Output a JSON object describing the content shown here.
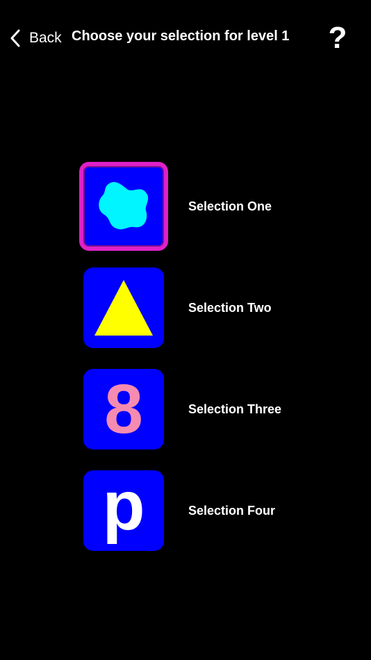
{
  "nav": {
    "back_label": "Back",
    "title": "Choose your selection for level 1",
    "help_symbol": "?"
  },
  "selections": [
    {
      "label": "Selection One",
      "icon": "blob-icon",
      "selected": true,
      "shape_color": "#00f5ff"
    },
    {
      "label": "Selection Two",
      "icon": "triangle-icon",
      "selected": false,
      "shape_color": "#ffff00"
    },
    {
      "label": "Selection Three",
      "icon": "digit-icon",
      "glyph": "8",
      "selected": false,
      "shape_color": "#f58bb0"
    },
    {
      "label": "Selection Four",
      "icon": "letter-icon",
      "glyph": "p",
      "selected": false,
      "shape_color": "#ffffff"
    }
  ],
  "colors": {
    "background": "#000000",
    "tile": "#0000ff",
    "selected_border": "#e020c8",
    "text": "#ffffff"
  }
}
